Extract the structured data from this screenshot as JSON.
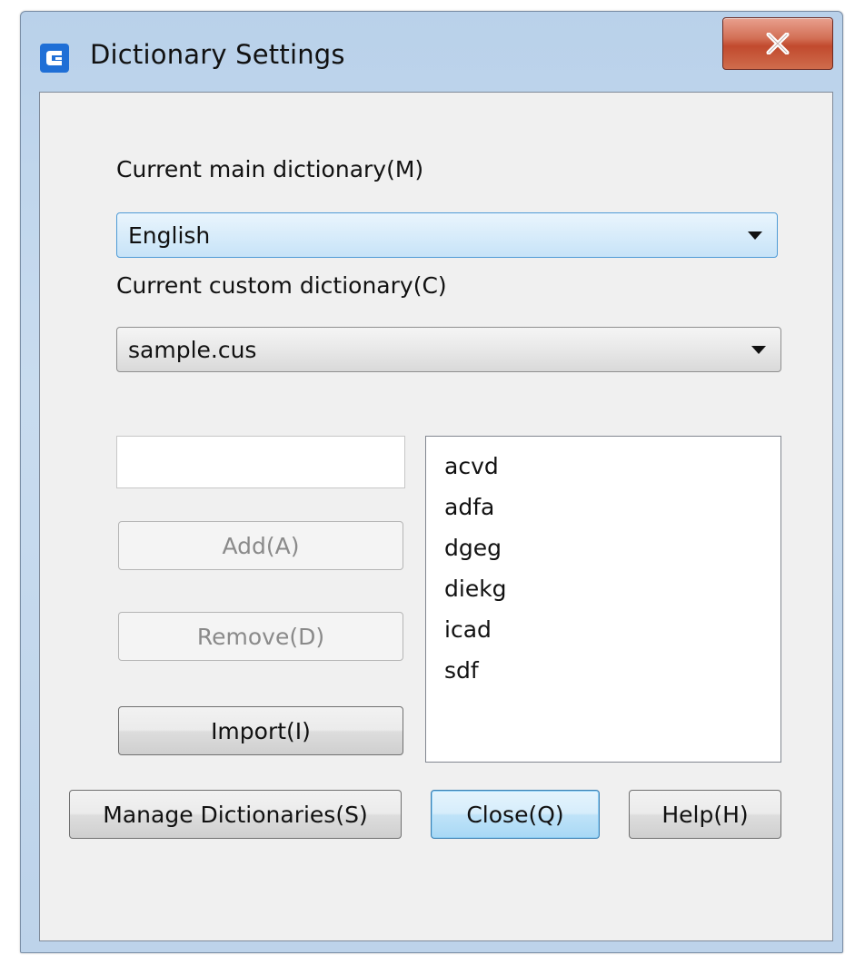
{
  "window": {
    "title": "Dictionary Settings",
    "close_glyph": "X"
  },
  "main_dictionary": {
    "label": "Current main dictionary(M)",
    "selected": "English"
  },
  "custom_dictionary": {
    "label": "Current custom dictionary(C)",
    "selected": "sample.cus"
  },
  "word_input": {
    "value": ""
  },
  "buttons": {
    "add": "Add(A)",
    "remove": "Remove(D)",
    "import": "Import(I)",
    "manage": "Manage Dictionaries(S)",
    "close": "Close(Q)",
    "help": "Help(H)"
  },
  "word_list": [
    "acvd",
    "adfa",
    "dgeg",
    "diekg",
    "icad",
    "sdf"
  ],
  "icons": {
    "app": "app-logo-icon",
    "close": "close-icon",
    "dropdown": "chevron-down-icon"
  },
  "colors": {
    "accent": "#4f9bd6",
    "close_button": "#c14a2e",
    "app_icon": "#1f6fd6"
  }
}
